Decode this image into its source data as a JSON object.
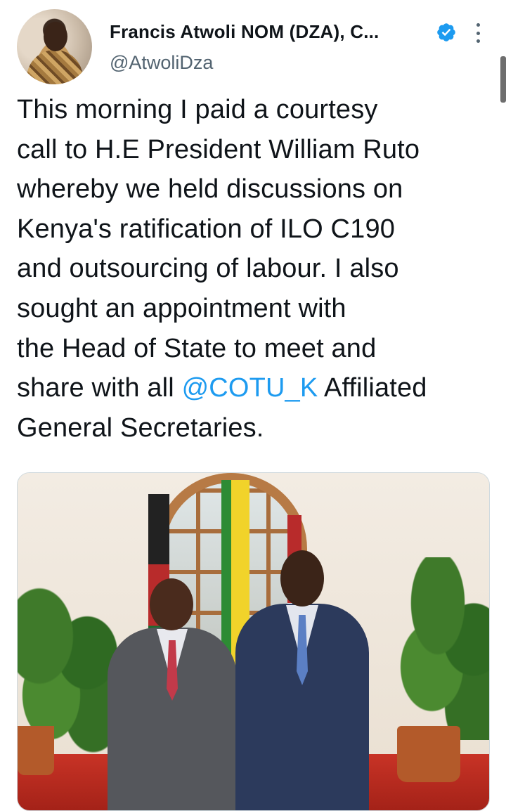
{
  "author": {
    "display_name": "Francis Atwoli NOM (DZA), C...",
    "handle": "@AtwoliDza",
    "verified": true,
    "avatar_icon": "profile-photo"
  },
  "tweet": {
    "lines": [
      "This morning I paid a courtesy",
      "call to H.E President William Ruto",
      "whereby we held discussions on",
      "Kenya's ratification of ILO C190",
      "and outsourcing of labour. I also",
      "sought an appointment with",
      "the Head of State to meet and"
    ],
    "last_line_prefix": "share with all ",
    "mention": "@COTU_K",
    "last_line_suffix": " Affiliated",
    "final_line": "General Secretaries."
  },
  "media": {
    "type": "photo",
    "icon": "tweet-photo"
  },
  "colors": {
    "accent": "#1d9bf0",
    "text": "#0f1419",
    "secondary": "#536471"
  },
  "icons": {
    "verified": "verified-badge-icon",
    "more": "more-options-icon"
  }
}
